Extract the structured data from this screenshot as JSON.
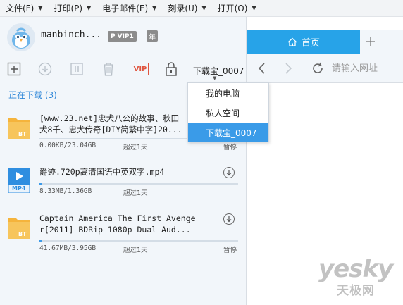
{
  "menubar": {
    "items": [
      {
        "label": "文件(F)"
      },
      {
        "label": "打印(P)"
      },
      {
        "label": "电子邮件(E)"
      },
      {
        "label": "刻录(U)"
      },
      {
        "label": "打开(O)"
      }
    ]
  },
  "user": {
    "name": "manbinch...",
    "vip_label": "VIP1",
    "year_label": "年"
  },
  "toolbar": {
    "vip_label": "VIP",
    "storage_selected": "下载宝_0007"
  },
  "dropdown": {
    "options": [
      {
        "label": "我的电脑"
      },
      {
        "label": "私人空间"
      },
      {
        "label": "下载宝_0007"
      }
    ],
    "selected_index": 2
  },
  "downloads": {
    "section_title": "正在下载 (3)",
    "items": [
      {
        "name_line1": "[www.23.net]忠犬八公的故事、秋田",
        "name_line2": "犬8千、忠犬传奇[DIY简繁中字]20...",
        "size": "0.00KB/23.04GB",
        "time": "超过1天",
        "status": "暂停",
        "progress": 0.0,
        "icon": "bt-folder-icon",
        "icon_label": "BT"
      },
      {
        "name_line1": "爵迹.720p高清国语中英双字.mp4",
        "name_line2": "",
        "size": "8.33MB/1.36GB",
        "time": "超过1天",
        "status": "",
        "progress": 0.006,
        "icon": "mp4-file-icon",
        "icon_label": "MP4"
      },
      {
        "name_line1": "Captain America The First Avenge",
        "name_line2": "r[2011] BDRip 1080p Dual Aud...",
        "size": "41.67MB/3.95GB",
        "time": "超过1天",
        "status": "暂停",
        "progress": 0.01,
        "icon": "bt-folder-icon",
        "icon_label": "BT"
      }
    ]
  },
  "browser": {
    "home_tab_label": "首页",
    "url_placeholder": "请输入网址"
  },
  "watermark": {
    "main": "yesky",
    "sub": "天极网"
  },
  "colors": {
    "accent": "#27a3e8",
    "section_title": "#2f87d8",
    "folder": "#f5b43c",
    "panel_bg": "#f2f6fa"
  }
}
